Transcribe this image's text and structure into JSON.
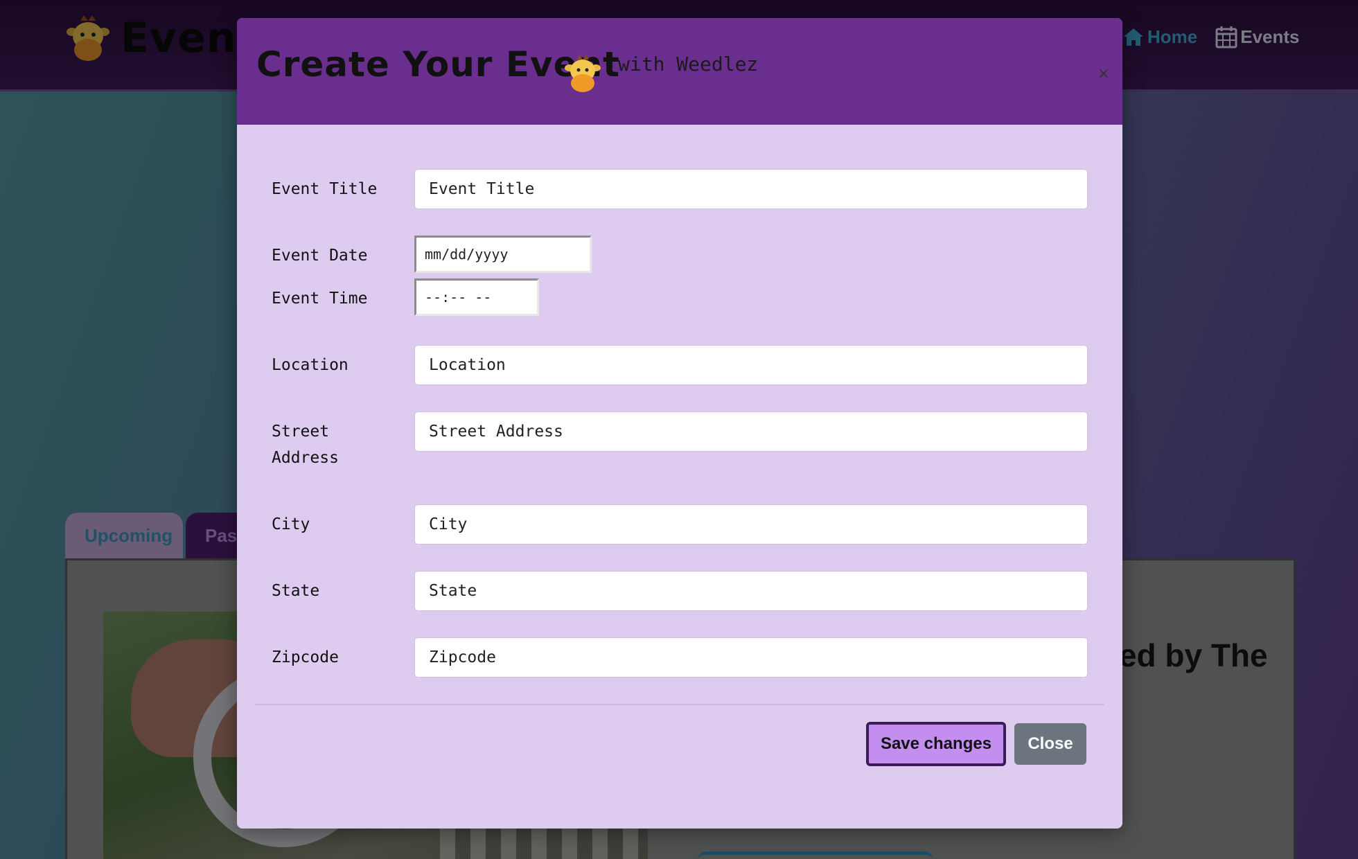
{
  "navbar": {
    "brand_text": "Eventf",
    "links": [
      {
        "label": "Home",
        "icon": "home-icon",
        "color": "#3aa3c8"
      },
      {
        "label": "Events",
        "icon": "calendar-icon"
      }
    ]
  },
  "tabs": [
    {
      "label": "Upcoming",
      "active": false
    },
    {
      "label": "Past",
      "active": true
    }
  ],
  "background_card": {
    "title_fragment": "red by The"
  },
  "modal": {
    "title": "Create Your Event",
    "subtitle": "with Weedlez",
    "close_symbol": "×",
    "fields": [
      {
        "label": "Event Title",
        "placeholder": "Event Title",
        "value": ""
      },
      {
        "label": "Event Date",
        "placeholder": "mm/dd/yyyy",
        "value": ""
      },
      {
        "label": "Event Time",
        "placeholder": "--:-- --",
        "value": ""
      },
      {
        "label": "Location",
        "placeholder": "Location",
        "value": ""
      },
      {
        "label": "Street Address",
        "placeholder": "Street Address",
        "value": ""
      },
      {
        "label": "City",
        "placeholder": "City",
        "value": ""
      },
      {
        "label": "State",
        "placeholder": "State",
        "value": ""
      },
      {
        "label": "Zipcode",
        "placeholder": "Zipcode",
        "value": ""
      }
    ],
    "buttons": {
      "save_label": "Save changes",
      "close_label": "Close"
    }
  },
  "colors": {
    "header_purple": "#6a2f8e",
    "modal_body": "#ddccf0",
    "save_button": "#c48ef0",
    "close_button": "#6c757d",
    "nav_accent": "#3aa3c8"
  }
}
